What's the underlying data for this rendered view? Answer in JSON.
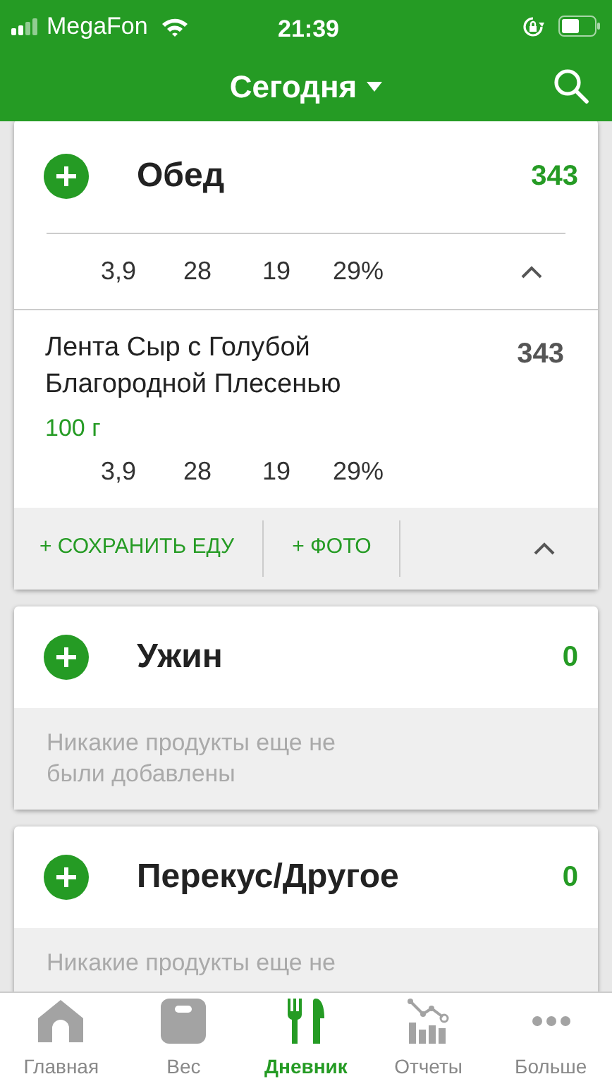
{
  "status_bar": {
    "carrier": "MegaFon",
    "time": "21:39"
  },
  "header": {
    "title": "Сегодня"
  },
  "meals": [
    {
      "name": "Обед",
      "calories": "343",
      "expanded": true,
      "totals": [
        "3,9",
        "28",
        "19",
        "29%"
      ],
      "foods": [
        {
          "name": "Лента Сыр с Голубой Благородной Плесенью",
          "amount": "100 г",
          "calories": "343",
          "nutrients": [
            "3,9",
            "28",
            "19",
            "29%"
          ]
        }
      ],
      "actions": [
        "+ СОХРАНИТЬ ЕДУ",
        "+ ФОТО"
      ]
    },
    {
      "name": "Ужин",
      "calories": "0",
      "expanded": false,
      "empty_text": "Никакие продукты еще не были добавлены"
    },
    {
      "name": "Перекус/Другое",
      "calories": "0",
      "expanded": false,
      "empty_text": "Никакие продукты еще не"
    }
  ],
  "tabs": [
    {
      "label": "Главная",
      "kind": "home",
      "selected": false
    },
    {
      "label": "Вес",
      "kind": "scale",
      "selected": false
    },
    {
      "label": "Дневник",
      "kind": "diary",
      "selected": true
    },
    {
      "label": "Отчеты",
      "kind": "reports",
      "selected": false
    },
    {
      "label": "Больше",
      "kind": "more",
      "selected": false
    }
  ]
}
